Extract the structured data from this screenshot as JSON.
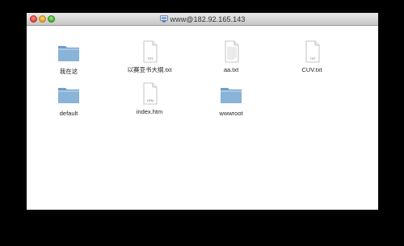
{
  "window": {
    "title": "www@182.92.165.143",
    "title_icon": "server-icon"
  },
  "files": [
    {
      "name": "我在这",
      "kind": "folder"
    },
    {
      "name": "以赛亚书大纲.txt",
      "kind": "txt",
      "badge": "TXT"
    },
    {
      "name": "aa.txt",
      "kind": "txt-lined"
    },
    {
      "name": "CUV.txt",
      "kind": "txt",
      "badge": "TXT"
    },
    {
      "name": "default",
      "kind": "folder"
    },
    {
      "name": "index.htm",
      "kind": "htm",
      "badge": "HTM"
    },
    {
      "name": "wwwroot",
      "kind": "folder"
    }
  ],
  "colors": {
    "folder": "#8ab3d8",
    "folder_dark": "#6d9dc8",
    "page": "#ffffff",
    "page_border": "#b5b5b5"
  }
}
